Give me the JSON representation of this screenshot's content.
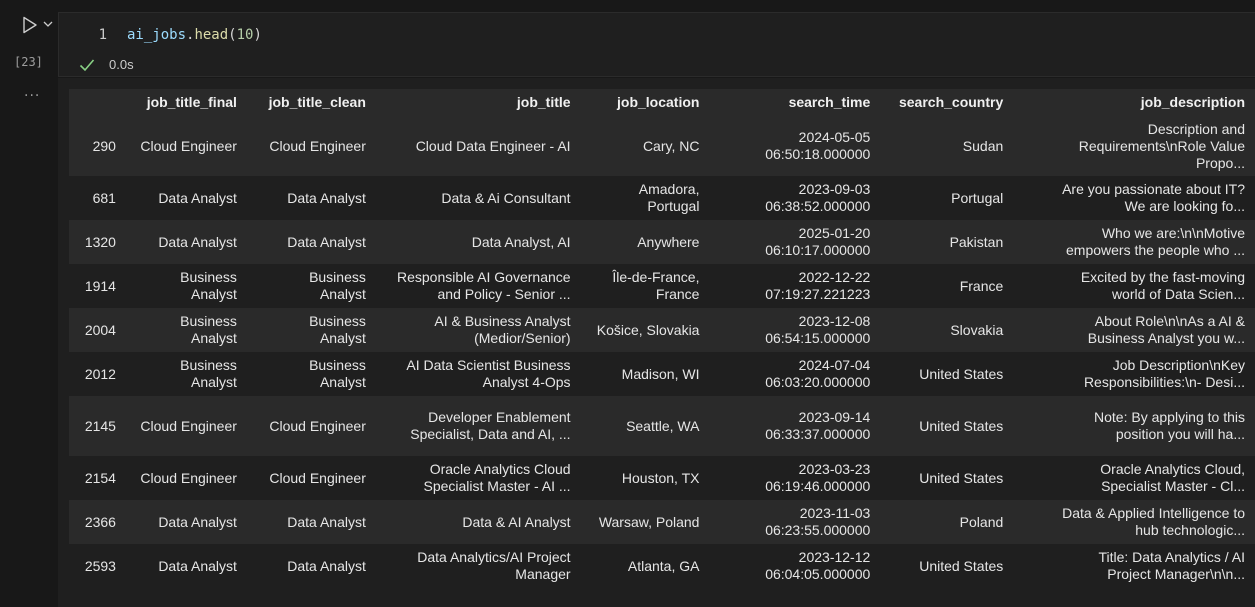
{
  "cell": {
    "execution_count": "[23]",
    "line_number": "1",
    "code": {
      "variable": "ai_jobs",
      "dot": ".",
      "method": "head",
      "open_paren": "(",
      "argument": "10",
      "close_paren": ")"
    },
    "elapsed": "0.0s",
    "more_label": "···"
  },
  "colors": {
    "background": "#181818",
    "cell_background": "#1f1f1f",
    "row_stripe": "#2a2a2a",
    "success": "#89d185"
  },
  "icons": {
    "run": "play-icon",
    "expand": "chevron-down-icon",
    "status": "check-icon"
  },
  "table": {
    "columns": [
      "",
      "job_title_final",
      "job_title_clean",
      "job_title",
      "job_location",
      "search_time",
      "search_country",
      "job_description"
    ],
    "rows": [
      {
        "index": "290",
        "job_title_final": "Cloud Engineer",
        "job_title_clean": "Cloud Engineer",
        "job_title": [
          "Cloud Data Engineer - AI"
        ],
        "job_location": [
          "Cary, NC"
        ],
        "search_time": [
          "2024-05-05",
          "06:50:18.000000"
        ],
        "search_country": "Sudan",
        "job_description": [
          "Description and",
          "Requirements\\nRole Value",
          "Propo..."
        ]
      },
      {
        "index": "681",
        "job_title_final": "Data Analyst",
        "job_title_clean": "Data Analyst",
        "job_title": [
          "Data & Ai Consultant"
        ],
        "job_location": [
          "Amadora,",
          "Portugal"
        ],
        "search_time": [
          "2023-09-03",
          "06:38:52.000000"
        ],
        "search_country": "Portugal",
        "job_description": [
          "Are you passionate about IT?",
          "We are looking fo..."
        ]
      },
      {
        "index": "1320",
        "job_title_final": "Data Analyst",
        "job_title_clean": "Data Analyst",
        "job_title": [
          "Data Analyst, AI"
        ],
        "job_location": [
          "Anywhere"
        ],
        "search_time": [
          "2025-01-20",
          "06:10:17.000000"
        ],
        "search_country": "Pakistan",
        "job_description": [
          "Who we are:\\n\\nMotive",
          "empowers the people who ..."
        ]
      },
      {
        "index": "1914",
        "job_title_final": "Business Analyst",
        "job_title_clean": "Business Analyst",
        "job_title": [
          "Responsible AI Governance",
          "and Policy - Senior ..."
        ],
        "job_location": [
          "Île-de-France,",
          "France"
        ],
        "search_time": [
          "2022-12-22",
          "07:19:27.221223"
        ],
        "search_country": "France",
        "job_description": [
          "Excited by the fast-moving",
          "world of Data Scien..."
        ]
      },
      {
        "index": "2004",
        "job_title_final": "Business Analyst",
        "job_title_clean": "Business Analyst",
        "job_title": [
          "AI & Business Analyst",
          "(Medior/Senior)"
        ],
        "job_location": [
          "Košice, Slovakia"
        ],
        "search_time": [
          "2023-12-08",
          "06:54:15.000000"
        ],
        "search_country": "Slovakia",
        "job_description": [
          "About Role\\n\\nAs a AI &",
          "Business Analyst you w..."
        ]
      },
      {
        "index": "2012",
        "job_title_final": "Business Analyst",
        "job_title_clean": "Business Analyst",
        "job_title": [
          "AI Data Scientist Business",
          "Analyst 4-Ops"
        ],
        "job_location": [
          "Madison, WI"
        ],
        "search_time": [
          "2024-07-04",
          "06:03:20.000000"
        ],
        "search_country": "United States",
        "job_description": [
          "Job Description\\nKey",
          "Responsibilities:\\n- Desi..."
        ]
      },
      {
        "index": "2145",
        "job_title_final": "Cloud Engineer",
        "job_title_clean": "Cloud Engineer",
        "job_title": [
          "Developer Enablement",
          "Specialist, Data and AI, ..."
        ],
        "job_location": [
          "Seattle, WA"
        ],
        "search_time": [
          "2023-09-14",
          "06:33:37.000000"
        ],
        "search_country": "United States",
        "job_description": [
          "Note: By applying to this",
          "position you will ha..."
        ]
      },
      {
        "index": "2154",
        "job_title_final": "Cloud Engineer",
        "job_title_clean": "Cloud Engineer",
        "job_title": [
          "Oracle Analytics Cloud",
          "Specialist Master - AI ..."
        ],
        "job_location": [
          "Houston, TX"
        ],
        "search_time": [
          "2023-03-23",
          "06:19:46.000000"
        ],
        "search_country": "United States",
        "job_description": [
          "Oracle Analytics Cloud,",
          "Specialist Master - Cl..."
        ]
      },
      {
        "index": "2366",
        "job_title_final": "Data Analyst",
        "job_title_clean": "Data Analyst",
        "job_title": [
          "Data & AI Analyst"
        ],
        "job_location": [
          "Warsaw, Poland"
        ],
        "search_time": [
          "2023-11-03",
          "06:23:55.000000"
        ],
        "search_country": "Poland",
        "job_description": [
          "Data & Applied Intelligence to",
          "hub technologic..."
        ]
      },
      {
        "index": "2593",
        "job_title_final": "Data Analyst",
        "job_title_clean": "Data Analyst",
        "job_title": [
          "Data Analytics/AI Project",
          "Manager"
        ],
        "job_location": [
          "Atlanta, GA"
        ],
        "search_time": [
          "2023-12-12",
          "06:04:05.000000"
        ],
        "search_country": "United States",
        "job_description": [
          "Title: Data Analytics / AI",
          "Project Manager\\n\\n..."
        ]
      }
    ]
  }
}
